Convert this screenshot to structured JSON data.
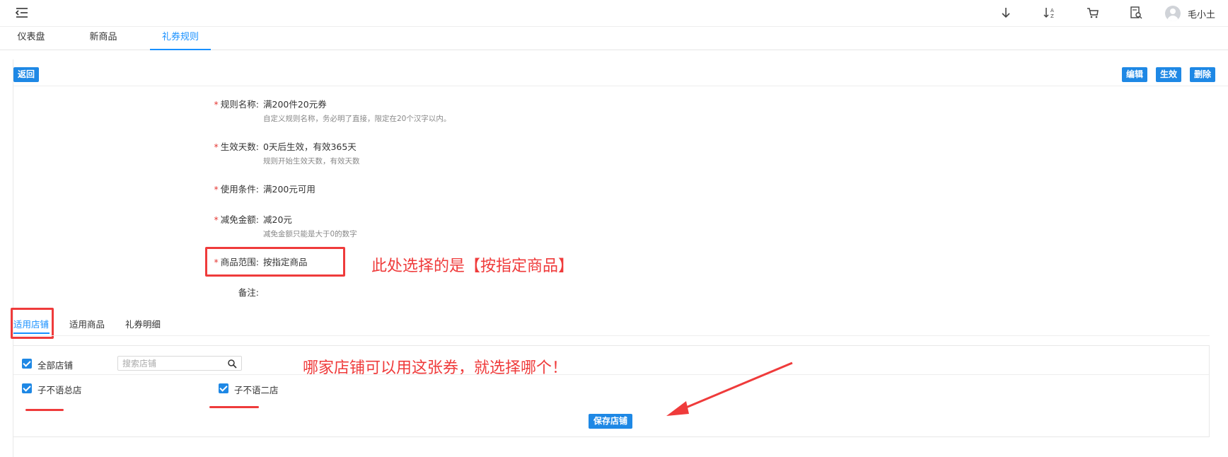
{
  "header": {
    "user_name": "毛小土",
    "icons": [
      "menu-fold-icon",
      "download-arrow-icon",
      "sort-az-icon",
      "cart-icon",
      "report-search-icon",
      "avatar-icon"
    ]
  },
  "tabs": [
    {
      "label": "仪表盘",
      "active": false
    },
    {
      "label": "新商品",
      "active": false
    },
    {
      "label": "礼券规则",
      "active": true
    }
  ],
  "toolbar": {
    "back_label": "返回",
    "edit_label": "编辑",
    "activate_label": "生效",
    "delete_label": "删除"
  },
  "form": {
    "rule_name": {
      "label": "规则名称:",
      "value": "满200件20元券",
      "hint": "自定义规则名称，务必明了直接，限定在20个汉字以内。",
      "required": true
    },
    "effective_days": {
      "label": "生效天数:",
      "value": "0天后生效，有效365天",
      "hint": "规则开始生效天数，有效天数",
      "required": true
    },
    "use_condition": {
      "label": "使用条件:",
      "value": "满200元可用",
      "required": true
    },
    "discount_amount": {
      "label": "减免金额:",
      "value": "减20元",
      "hint": "减免金额只能是大于0的数字",
      "required": true
    },
    "product_scope": {
      "label": "商品范围:",
      "value": "按指定商品",
      "required": true
    },
    "remark": {
      "label": "备注:",
      "value": ""
    },
    "required_mark": "*"
  },
  "annotations": {
    "scope_note": "此处选择的是【按指定商品】",
    "store_note": "哪家店铺可以用这张券，就选择哪个！"
  },
  "sub_tabs": [
    {
      "label": "适用店铺",
      "active": true
    },
    {
      "label": "适用商品",
      "active": false
    },
    {
      "label": "礼券明细",
      "active": false
    }
  ],
  "stores": {
    "all_label": "全部店铺",
    "all_checked": true,
    "search_placeholder": "搜索店铺",
    "items": [
      {
        "label": "子不语总店",
        "checked": true
      },
      {
        "label": "子不语二店",
        "checked": true
      }
    ],
    "save_label": "保存店铺"
  },
  "colors": {
    "accent": "#1e88e5",
    "tab_active": "#1890ff",
    "annotation": "#ef3b3b"
  }
}
